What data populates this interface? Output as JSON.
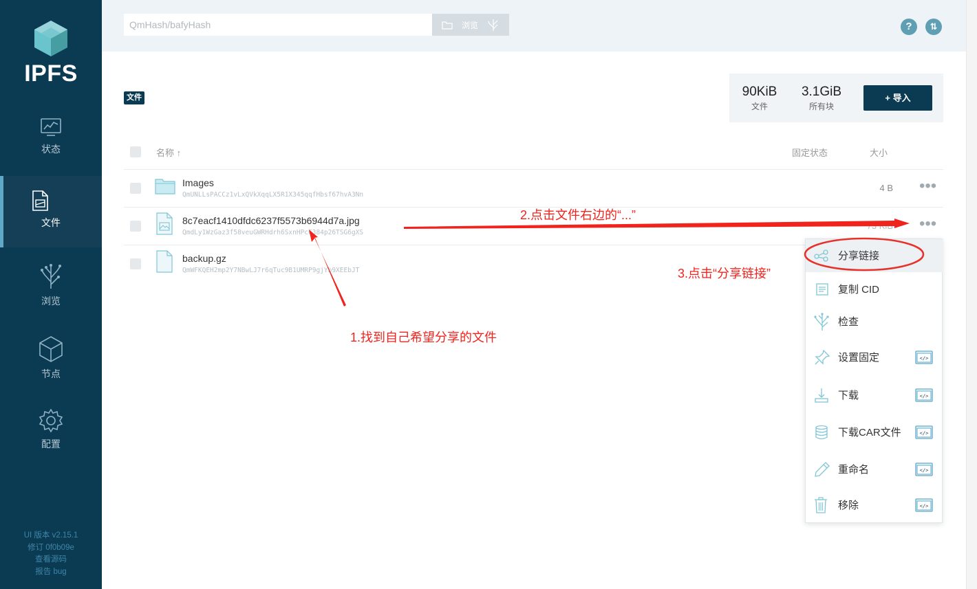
{
  "sidebar": {
    "logo_text": "IPFS",
    "items": [
      {
        "label": "状态",
        "icon": "status-chart-icon"
      },
      {
        "label": "文件",
        "icon": "files-icon"
      },
      {
        "label": "浏览",
        "icon": "explore-tree-icon"
      },
      {
        "label": "节点",
        "icon": "peers-cube-icon"
      },
      {
        "label": "配置",
        "icon": "settings-gear-icon"
      }
    ],
    "active_index": 1,
    "version": {
      "ui_version": "UI 版本 v2.15.1",
      "revision": "修订 0f0b09e",
      "source_link": "查看源码",
      "bug_link": "报告 bug"
    }
  },
  "topbar": {
    "search_placeholder": "QmHash/bafyHash",
    "browse_label": "浏览",
    "help_icon": "question-icon",
    "sync_icon": "sync-arrows-icon"
  },
  "breadcrumb": {
    "label": "文件"
  },
  "stats": {
    "files_value": "90KiB",
    "files_label": "文件",
    "blocks_value": "3.1GiB",
    "blocks_label": "所有块",
    "import_label": "+ 导入"
  },
  "table": {
    "headers": {
      "name": "名称 ↑",
      "pin_status": "固定状态",
      "size": "大小"
    },
    "rows": [
      {
        "name": "Images",
        "hash": "QmUNLLsPACCz1vLxQVkXqqLX5R1X345qqfHbsf67hvA3Nn",
        "size": "4 B",
        "icon": "folder-icon"
      },
      {
        "name": "8c7eacf1410dfdc6237f5573b6944d7a.jpg",
        "hash": "QmdLy1WzGaz3f58veuGWRHdrh6SxnHPcC384p26TSG6gXS",
        "size": "73 KiB",
        "icon": "image-file-icon"
      },
      {
        "name": "backup.gz",
        "hash": "QmWFKQEH2mp2Y7NBwLJ7r6qTuc9B1UMRP9gjYb9XEEbJT",
        "size": "",
        "icon": "file-icon"
      }
    ]
  },
  "context_menu": {
    "items": [
      {
        "label": "分享链接",
        "icon": "share-icon",
        "badge": false
      },
      {
        "label": "复制 CID",
        "icon": "copy-icon",
        "badge": false
      },
      {
        "label": "检查",
        "icon": "inspect-tree-icon",
        "badge": false
      },
      {
        "label": "设置固定",
        "icon": "pin-icon",
        "badge": true
      },
      {
        "label": "下载",
        "icon": "download-icon",
        "badge": true
      },
      {
        "label": "下载CAR文件",
        "icon": "database-icon",
        "badge": true
      },
      {
        "label": "重命名",
        "icon": "pencil-icon",
        "badge": true
      },
      {
        "label": "移除",
        "icon": "trash-icon",
        "badge": true
      }
    ]
  },
  "annotations": {
    "step1": "1.找到自己希望分享的文件",
    "step2": "2.点击文件右边的“...”",
    "step3": "3.点击“分享链接”"
  },
  "colors": {
    "sidebar_bg": "#0b3a53",
    "accent": "#5f9fb4",
    "annotation_red": "#f0231d"
  }
}
